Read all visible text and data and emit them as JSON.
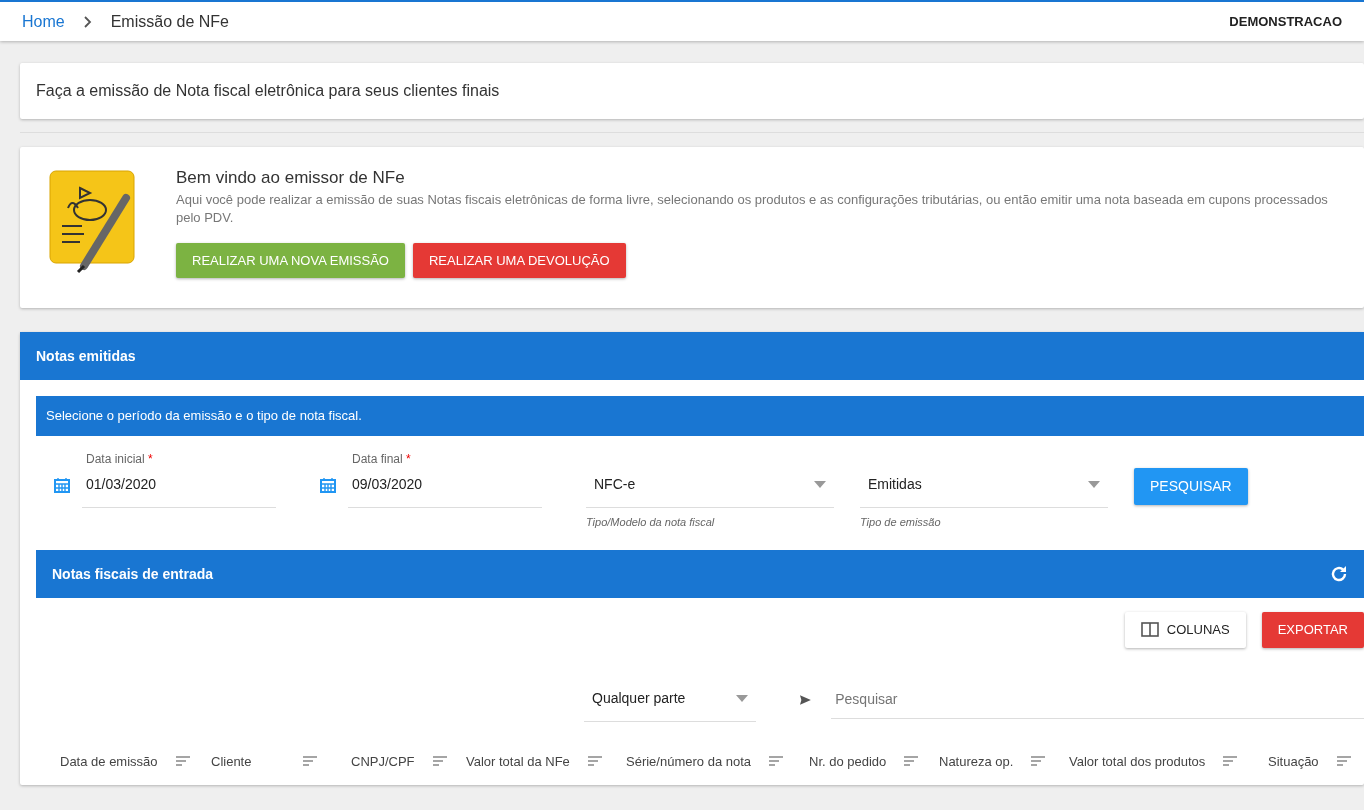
{
  "breadcrumb": [
    {
      "label": "Home",
      "kind": "link"
    },
    {
      "label": "Emissão de NFe",
      "kind": "current"
    }
  ],
  "user": "DEMONSTRACAO",
  "intro": "Faça a emissão de Nota fiscal eletrônica para seus clientes finais",
  "welcome": {
    "title": "Bem vindo ao emissor de NFe",
    "text": "Aqui você pode realizar a emissão de suas Notas fiscais eletrônicas de forma livre, selecionando os produtos e as configurações tributárias, ou então emitir uma nota baseada em cupons processados pelo PDV.",
    "buttons": [
      {
        "label": "REALIZAR UMA NOVA EMISSÃO",
        "kind": "success"
      },
      {
        "label": "REALIZAR UMA DEVOLUÇÃO",
        "kind": "danger"
      }
    ]
  },
  "notes_panel": {
    "title": "Notas emitidas",
    "info": "Selecione o período da emissão e o tipo de nota fiscal.",
    "filters": [
      {
        "kind": "date",
        "label": "Data inicial",
        "required_mark": "*",
        "value": "01/03/2020"
      },
      {
        "kind": "date",
        "label": "Data final",
        "required_mark": "*",
        "value": "09/03/2020"
      },
      {
        "kind": "select",
        "value": "NFC-e",
        "helper": "Tipo/Modelo da nota fiscal"
      },
      {
        "kind": "select",
        "value": "Emitidas",
        "helper": "Tipo de emissão"
      }
    ],
    "search_button": "PESQUISAR"
  },
  "table_panel": {
    "title": "Notas fiscais de entrada",
    "buttons": [
      {
        "label": "COLUNAS",
        "kind": "columns"
      },
      {
        "label": "EXPORTAR",
        "kind": "export"
      }
    ],
    "match_select": "Qualquer parte",
    "search_placeholder": "Pesquisar",
    "columns": [
      "Data de emissão",
      "Cliente",
      "CNPJ/CPF",
      "Valor total da NFe",
      "Série/número da nota",
      "Nr. do pedido",
      "Natureza op.",
      "Valor total dos produtos",
      "Situação"
    ]
  }
}
